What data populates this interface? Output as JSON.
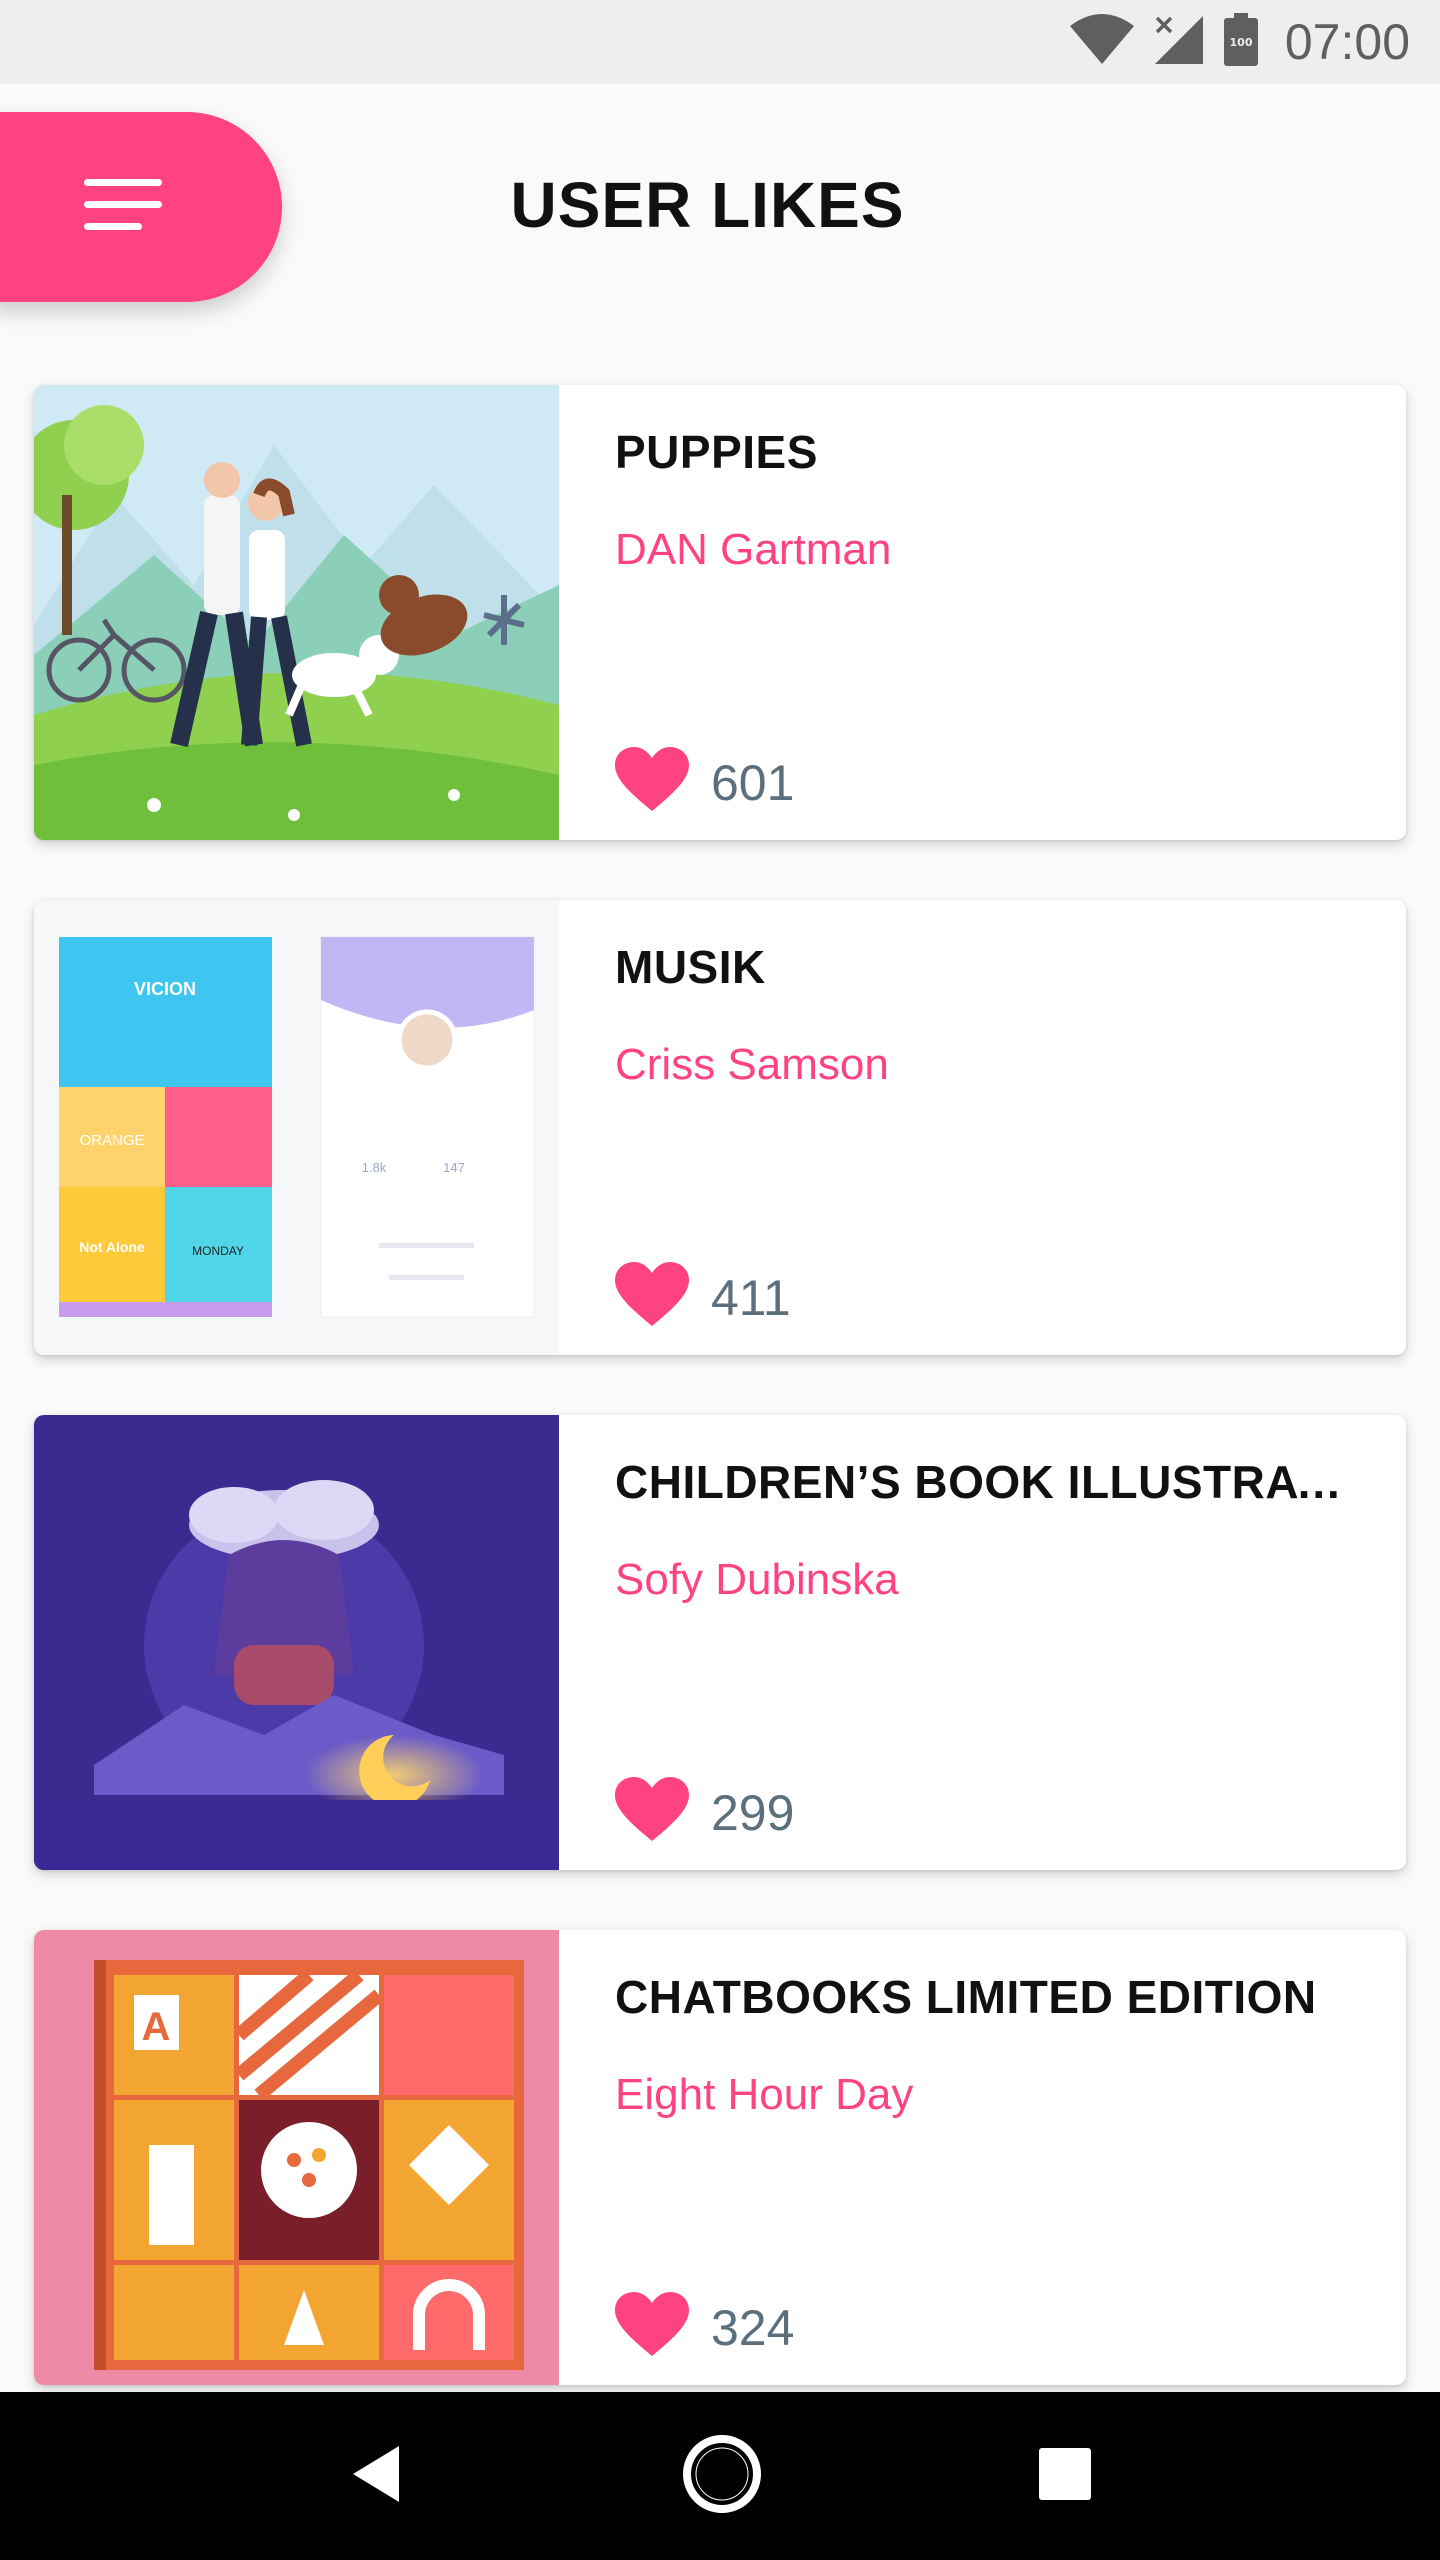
{
  "status_bar": {
    "time": "07:00",
    "icons": [
      "wifi-icon",
      "cell-signal-icon",
      "battery-icon"
    ],
    "battery_label": "100"
  },
  "header": {
    "title": "USER LIKES",
    "menu_icon": "menu-icon"
  },
  "colors": {
    "accent": "#ff4281",
    "likes_text": "#5c6f7d",
    "background": "#fafafa"
  },
  "cards": [
    {
      "title": "PUPPIES",
      "author": "DAN Gartman",
      "likes": "601",
      "image": "couple-walking-dogs-illustration"
    },
    {
      "title": "MUSIK",
      "author": "Criss Samson",
      "likes": "411",
      "image": "music-app-screens-illustration"
    },
    {
      "title": "CHILDREN’S BOOK ILLUSTRATION",
      "author": "Sofy Dubinska",
      "likes": "299",
      "image": "girl-cloud-moon-illustration"
    },
    {
      "title": "CHATBOOKS LIMITED EDITION",
      "author": "Eight Hour Day",
      "likes": "324",
      "image": "geometric-book-cover-illustration"
    }
  ],
  "thumb_text": {
    "app_name": "VICION",
    "tile_orange": "ORANGE",
    "tile_not_alone": "Not Alone",
    "tile_monday": "MONDAY",
    "profile_followers": "1.8k",
    "profile_following": "147",
    "book_letter": "A"
  },
  "nav_bar": {
    "buttons": [
      "back-icon",
      "home-icon",
      "recents-icon"
    ]
  }
}
